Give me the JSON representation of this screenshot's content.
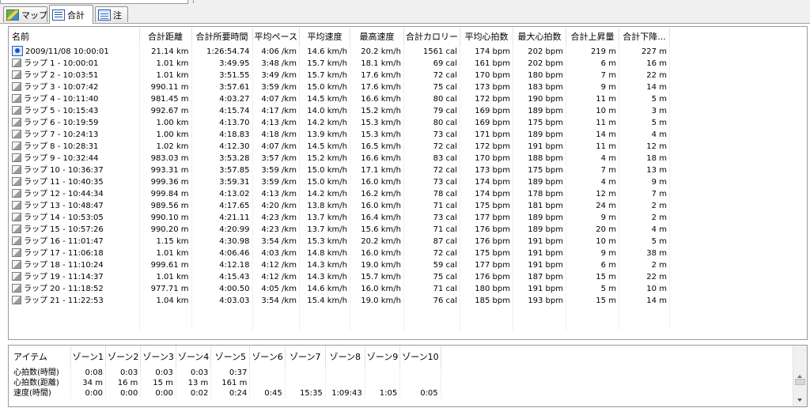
{
  "tabs": [
    {
      "label": "マップ",
      "icon": "map-icon"
    },
    {
      "label": "合計",
      "icon": "list-icon"
    },
    {
      "label": "注",
      "icon": "note-icon"
    }
  ],
  "laps": {
    "columns": [
      "名前",
      "合計距離",
      "合計所要時間",
      "平均ペース",
      "平均速度",
      "最高速度",
      "合計カロリー",
      "平均心拍数",
      "最大心拍数",
      "合計上昇量",
      "合計下降..."
    ],
    "rows": [
      [
        "2009/11/08 10:00:01",
        "21.14 km",
        "1:26:54.74",
        "4:06 /km",
        "14.6 km/h",
        "20.2 km/h",
        "1561 cal",
        "174 bpm",
        "202 bpm",
        "219 m",
        "227 m"
      ],
      [
        "ラップ 1 - 10:00:01",
        "1.01 km",
        "3:49.95",
        "3:48 /km",
        "15.7 km/h",
        "18.1 km/h",
        "69 cal",
        "161 bpm",
        "202 bpm",
        "6 m",
        "16 m"
      ],
      [
        "ラップ 2 - 10:03:51",
        "1.01 km",
        "3:51.55",
        "3:49 /km",
        "15.7 km/h",
        "17.6 km/h",
        "72 cal",
        "170 bpm",
        "180 bpm",
        "7 m",
        "22 m"
      ],
      [
        "ラップ 3 - 10:07:42",
        "990.11 m",
        "3:57.61",
        "3:59 /km",
        "15.0 km/h",
        "17.6 km/h",
        "75 cal",
        "173 bpm",
        "183 bpm",
        "9 m",
        "14 m"
      ],
      [
        "ラップ 4 - 10:11:40",
        "981.45 m",
        "4:03.27",
        "4:07 /km",
        "14.5 km/h",
        "16.6 km/h",
        "80 cal",
        "172 bpm",
        "190 bpm",
        "11 m",
        "5 m"
      ],
      [
        "ラップ 5 - 10:15:43",
        "992.67 m",
        "4:15.74",
        "4:17 /km",
        "14.0 km/h",
        "15.2 km/h",
        "79 cal",
        "169 bpm",
        "189 bpm",
        "10 m",
        "3 m"
      ],
      [
        "ラップ 6 - 10:19:59",
        "1.00 km",
        "4:13.70",
        "4:13 /km",
        "14.2 km/h",
        "15.3 km/h",
        "80 cal",
        "169 bpm",
        "175 bpm",
        "11 m",
        "5 m"
      ],
      [
        "ラップ 7 - 10:24:13",
        "1.00 km",
        "4:18.83",
        "4:18 /km",
        "13.9 km/h",
        "15.3 km/h",
        "73 cal",
        "171 bpm",
        "189 bpm",
        "14 m",
        "4 m"
      ],
      [
        "ラップ 8 - 10:28:31",
        "1.02 km",
        "4:12.30",
        "4:07 /km",
        "14.5 km/h",
        "16.5 km/h",
        "72 cal",
        "172 bpm",
        "191 bpm",
        "11 m",
        "12 m"
      ],
      [
        "ラップ 9 - 10:32:44",
        "983.03 m",
        "3:53.28",
        "3:57 /km",
        "15.2 km/h",
        "16.6 km/h",
        "83 cal",
        "170 bpm",
        "188 bpm",
        "4 m",
        "18 m"
      ],
      [
        "ラップ 10 - 10:36:37",
        "993.31 m",
        "3:57.85",
        "3:59 /km",
        "15.0 km/h",
        "17.1 km/h",
        "72 cal",
        "173 bpm",
        "175 bpm",
        "7 m",
        "13 m"
      ],
      [
        "ラップ 11 - 10:40:35",
        "999.36 m",
        "3:59.31",
        "3:59 /km",
        "15.0 km/h",
        "16.0 km/h",
        "73 cal",
        "174 bpm",
        "189 bpm",
        "4 m",
        "9 m"
      ],
      [
        "ラップ 12 - 10:44:34",
        "999.84 m",
        "4:13.02",
        "4:13 /km",
        "14.2 km/h",
        "16.2 km/h",
        "78 cal",
        "174 bpm",
        "178 bpm",
        "12 m",
        "7 m"
      ],
      [
        "ラップ 13 - 10:48:47",
        "989.56 m",
        "4:17.65",
        "4:20 /km",
        "13.8 km/h",
        "16.0 km/h",
        "71 cal",
        "175 bpm",
        "181 bpm",
        "24 m",
        "2 m"
      ],
      [
        "ラップ 14 - 10:53:05",
        "990.10 m",
        "4:21.11",
        "4:23 /km",
        "13.7 km/h",
        "16.4 km/h",
        "73 cal",
        "177 bpm",
        "189 bpm",
        "9 m",
        "2 m"
      ],
      [
        "ラップ 15 - 10:57:26",
        "990.20 m",
        "4:20.99",
        "4:23 /km",
        "13.7 km/h",
        "15.6 km/h",
        "71 cal",
        "176 bpm",
        "189 bpm",
        "20 m",
        "4 m"
      ],
      [
        "ラップ 16 - 11:01:47",
        "1.15 km",
        "4:30.98",
        "3:54 /km",
        "15.3 km/h",
        "20.2 km/h",
        "87 cal",
        "176 bpm",
        "191 bpm",
        "10 m",
        "5 m"
      ],
      [
        "ラップ 17 - 11:06:18",
        "1.01 km",
        "4:06.46",
        "4:03 /km",
        "14.8 km/h",
        "16.0 km/h",
        "72 cal",
        "175 bpm",
        "191 bpm",
        "9 m",
        "38 m"
      ],
      [
        "ラップ 18 - 11:10:24",
        "999.61 m",
        "4:12.18",
        "4:12 /km",
        "14.3 km/h",
        "19.0 km/h",
        "59 cal",
        "177 bpm",
        "191 bpm",
        "6 m",
        "2 m"
      ],
      [
        "ラップ 19 - 11:14:37",
        "1.01 km",
        "4:15.43",
        "4:12 /km",
        "14.3 km/h",
        "15.7 km/h",
        "75 cal",
        "176 bpm",
        "187 bpm",
        "15 m",
        "22 m"
      ],
      [
        "ラップ 20 - 11:18:52",
        "977.71 m",
        "4:00.50",
        "4:05 /km",
        "14.6 km/h",
        "16.0 km/h",
        "71 cal",
        "180 bpm",
        "191 bpm",
        "5 m",
        "10 m"
      ],
      [
        "ラップ 21 - 11:22:53",
        "1.04 km",
        "4:03.03",
        "3:54 /km",
        "15.4 km/h",
        "19.0 km/h",
        "76 cal",
        "185 bpm",
        "193 bpm",
        "15 m",
        "14 m"
      ]
    ]
  },
  "zones": {
    "columns": [
      "アイテム",
      "ゾーン1",
      "ゾーン2",
      "ゾーン3",
      "ゾーン4",
      "ゾーン5",
      "ゾーン6",
      "ゾーン7",
      "ゾーン8",
      "ゾーン9",
      "ゾーン10"
    ],
    "rows": [
      [
        "心拍数(時間)",
        "0:08",
        "0:03",
        "0:03",
        "0:03",
        "0:37",
        "",
        "",
        "",
        "",
        ""
      ],
      [
        "心拍数(距離)",
        "34 m",
        "16 m",
        "15 m",
        "13 m",
        "161 m",
        "",
        "",
        "",
        "",
        ""
      ],
      [
        "速度(時間)",
        "0:00",
        "0:00",
        "0:00",
        "0:02",
        "0:24",
        "0:45",
        "15:35",
        "1:09:43",
        "1:05",
        "0:05"
      ]
    ]
  }
}
